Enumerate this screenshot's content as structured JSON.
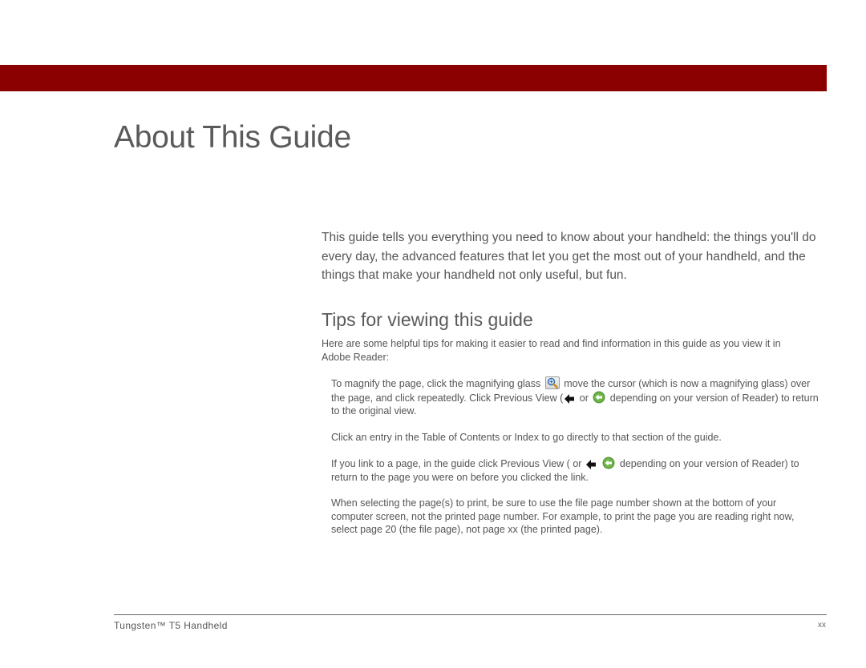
{
  "header": {
    "bar_color": "#8b0000"
  },
  "page": {
    "title": "About This Guide",
    "intro": "This guide tells you everything you need to know about your handheld: the things you'll do every day, the advanced features that let you get the most out of your handheld, and the things that make your handheld not only useful, but fun."
  },
  "tips_section": {
    "heading": "Tips for viewing this guide",
    "intro": "Here are some helpful tips for making it easier to read and find information in this guide as you view it in Adobe Reader:",
    "tips": [
      {
        "part1": "To magnify the page, click the magnifying glass ",
        "icon1": "magnifying-glass-icon",
        "part2": " move the cursor (which is now a magnifying glass) over the page, and click repeatedly. Click Previous View (",
        "icon2": "back-arrow-icon",
        "part3": " or ",
        "icon3": "green-back-icon",
        "part4": " depending on your version of Reader) to return to the original view."
      },
      {
        "text": "Click an entry in the Table of Contents or Index to go directly to that section of the guide."
      },
      {
        "part1": "If you link to a page, in the guide click Previous View ( or ",
        "icon1": "back-arrow-icon",
        "part2": " ",
        "icon2": "green-back-icon",
        "part3": " depending on your version of Reader) to return to the page you were on before you clicked the link."
      },
      {
        "text": "When selecting the page(s) to print, be sure to use the file page number shown at the bottom of your computer screen, not the printed page number. For example, to print the page you are reading right now, select page 20 (the file page), not page xx (the printed page)."
      }
    ]
  },
  "footer": {
    "product": "Tungsten™ T5 Handheld",
    "page_number": "xx"
  }
}
